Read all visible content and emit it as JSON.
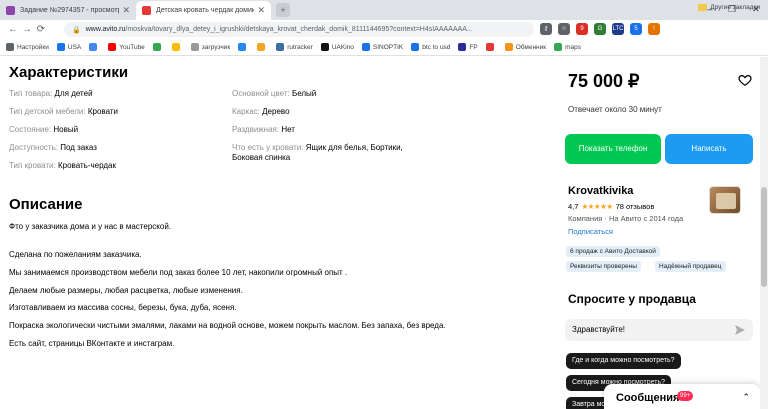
{
  "browser": {
    "tabs": [
      {
        "title": "Задание №2974357 - просмотр з",
        "favicon_color": "#8e44ad"
      },
      {
        "title": "Детская кровать чердак домик с",
        "favicon_color": "#e53935"
      }
    ],
    "close_glyph": "✕",
    "new_tab_glyph": "+",
    "window_buttons": [
      "—",
      "❐",
      "✕"
    ],
    "nav": {
      "back": "←",
      "forward": "→",
      "reload": "⟳"
    },
    "url_lock": "🔒",
    "url_host": "www.avito.ru",
    "url_path": "/moskva/tovary_dlya_detey_i_igrushki/detskaya_krovat_cherdak_domik_8111144695?context=H4sIAAAAAAA...",
    "extensions": [
      {
        "name": "key-icon",
        "glyph": "⚷",
        "color": "#5f6368"
      },
      {
        "name": "star-icon",
        "glyph": "☆",
        "color": "#5f6368"
      },
      {
        "name": "ext-red",
        "glyph": "9",
        "color": "#d93025"
      },
      {
        "name": "ext-green",
        "glyph": "G",
        "color": "#2e7d32"
      },
      {
        "name": "ltc-ext",
        "glyph": "LTC",
        "color": "#1e3a8a"
      },
      {
        "name": "ext-blue",
        "glyph": "5",
        "color": "#1a73e8"
      },
      {
        "name": "ext-orange",
        "glyph": "!",
        "color": "#e37400"
      }
    ],
    "bookmarks": [
      {
        "label": "Настройки",
        "color": "#5f6368"
      },
      {
        "label": "USA",
        "color": "#1a73e8"
      },
      {
        "label": "",
        "color": "#4285f4"
      },
      {
        "label": "YouTube",
        "color": "#ff0000"
      },
      {
        "label": "",
        "color": "#34a853"
      },
      {
        "label": "",
        "color": "#fbbc05"
      },
      {
        "label": "загрузчик",
        "color": "#999999"
      },
      {
        "label": "",
        "color": "#2787f5"
      },
      {
        "label": "",
        "color": "#f5a623"
      },
      {
        "label": "rutracker",
        "color": "#3b6ea5"
      },
      {
        "label": "UAKino",
        "color": "#111111"
      },
      {
        "label": "SINOPTIK",
        "color": "#1a73e8"
      },
      {
        "label": "btc to usd",
        "color": "#1a73e8"
      },
      {
        "label": "FP",
        "color": "#2b2b9e"
      },
      {
        "label": "",
        "color": "#e53935"
      },
      {
        "label": "Обменник",
        "color": "#f7931a"
      },
      {
        "label": "maps",
        "color": "#34a853"
      }
    ],
    "other_bookmarks": "Другие закладки"
  },
  "characteristics": {
    "title": "Характеристики",
    "left": [
      {
        "key": "Тип товара:",
        "value": "Для детей"
      },
      {
        "key": "Тип детской мебели:",
        "value": "Кровати"
      },
      {
        "key": "Состояние:",
        "value": "Новый"
      },
      {
        "key": "Доступность:",
        "value": "Под заказ"
      },
      {
        "key": "Тип кровати:",
        "value": "Кровать-чердак"
      }
    ],
    "right": [
      {
        "key": "Основной цвет:",
        "value": "Белый"
      },
      {
        "key": "Каркас:",
        "value": "Дерево"
      },
      {
        "key": "Раздвижная:",
        "value": "Нет"
      },
      {
        "key": "Что есть у кровати:",
        "value": "Ящик для белья, Бортики, Боковая спинка"
      }
    ]
  },
  "description": {
    "title": "Описание",
    "paragraphs": [
      "Фто у заказчика дома и у нас в мастерской.",
      "Сделана по пожеланиям заказчика.",
      "Мы занимаемся производством мебели под заказ более 10 лет, накопили огромный опыт .",
      "Делаем любые размеры, любая расцветка, любые изменения.",
      "Изготавливаем из массива сосны, березы, бука, дуба, ясеня.",
      "Покраска экологически чистыми эмалями, лаками на водной основе, можем покрыть маслом. Без запаха, без вреда.",
      "Есть сайт, страницы ВКонтакте и инстаграм."
    ]
  },
  "sidebar": {
    "price": "75 000 ₽",
    "reply_time": "Отвечает около 30 минут",
    "phone_button": "Показать телефон",
    "write_button": "Написать",
    "seller": {
      "name": "Krovatkivika",
      "rating": "4,7",
      "stars": "★★★★★",
      "reviews": "78 отзывов",
      "company": "Компания · На Авито с 2014 года",
      "subscribe": "Подписаться",
      "badges": [
        "6 продаж с Авито Доставкой",
        "Реквизиты проверены",
        "Надёжный продавец"
      ]
    },
    "ask": {
      "title": "Спросите у продавца",
      "input_value": "Здравствуйте!",
      "questions": [
        "Где и когда можно посмотреть?",
        "Сегодня можно посмотреть?",
        "Завтра можно посмотреть?"
      ]
    },
    "messages": {
      "title": "Сообщения",
      "count": "99+"
    }
  },
  "colors": {
    "green": "#00c853",
    "blue": "#1d9bf0",
    "star": "#f5a623",
    "link": "#1d78d6"
  }
}
